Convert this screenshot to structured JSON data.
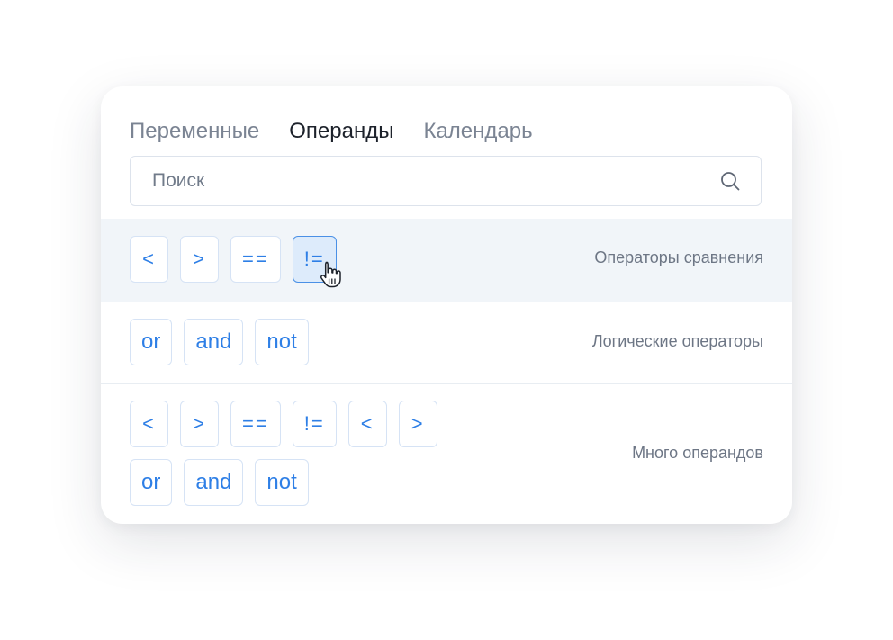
{
  "tabs": [
    {
      "label": "Переменные",
      "active": false
    },
    {
      "label": "Операнды",
      "active": true
    },
    {
      "label": "Календарь",
      "active": false
    }
  ],
  "search": {
    "placeholder": "Поиск",
    "value": "",
    "icon": "search-icon"
  },
  "sections": [
    {
      "label": "Операторы сравнения",
      "operators": [
        "<",
        ">",
        "==",
        "!="
      ],
      "active_operator": "!="
    },
    {
      "label": "Логические операторы",
      "operators": [
        "or",
        "and",
        "not"
      ]
    },
    {
      "label": "Много операндов",
      "operators_row1": [
        "<",
        ">",
        "==",
        "!=",
        "<",
        ">"
      ],
      "operators_row2": [
        "or",
        "and",
        "not"
      ]
    }
  ],
  "colors": {
    "accent": "#2e7fe6",
    "active_bg": "#ddebfb",
    "highlight_row": "#f1f5f9"
  }
}
